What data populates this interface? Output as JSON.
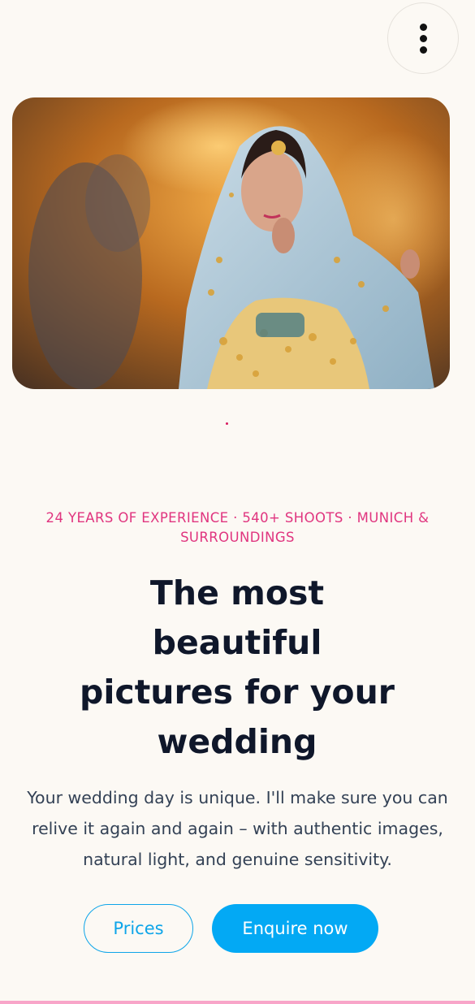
{
  "header": {
    "menu_icon": "more-vertical-icon"
  },
  "hero": {
    "image_alt": "Bride in embroidered light-blue veil with golden jewelry",
    "carousel_indicator_color": "#d81b60"
  },
  "intro": {
    "eyebrow": "24 YEARS OF EXPERIENCE · 540+ SHOOTS · MUNICH & SURROUNDINGS",
    "headline": "The most beautiful pictures for your wedding",
    "lead": "Your wedding day is unique. I'll make sure you can relive it again and again – with authentic images, natural light, and genuine sensitivity."
  },
  "actions": {
    "prices_label": "Prices",
    "enquire_label": "Enquire now"
  },
  "colors": {
    "accent_pink": "#e0357f",
    "primary_blue": "#03a9f4",
    "heading": "#0f172a",
    "background": "#fcf9f4"
  }
}
